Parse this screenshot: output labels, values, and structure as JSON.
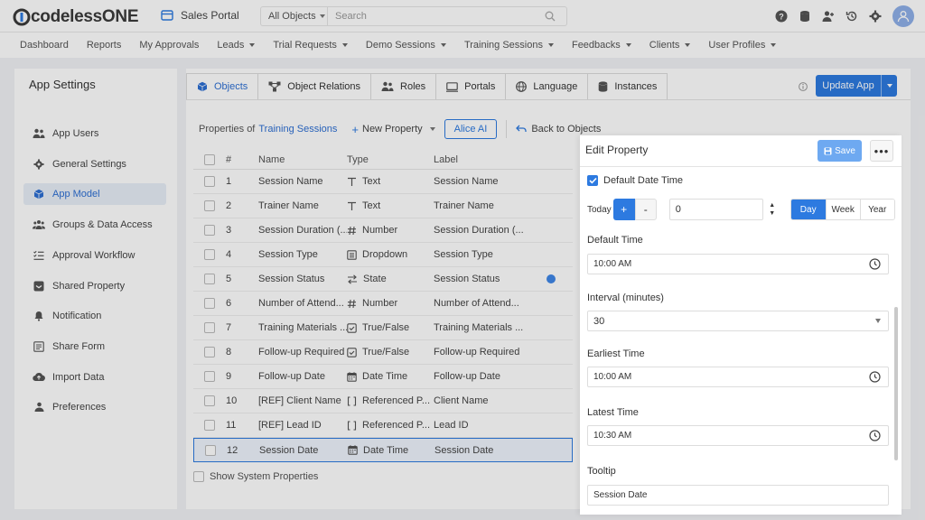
{
  "brand": {
    "logo_text": "codelessONE"
  },
  "portal": {
    "name": "Sales Portal"
  },
  "search": {
    "scope": "All Objects",
    "placeholder": "Search"
  },
  "nav": [
    "Dashboard",
    "Reports",
    "My Approvals",
    "Leads",
    "Trial Requests",
    "Demo Sessions",
    "Training Sessions",
    "Feedbacks",
    "Clients",
    "User Profiles"
  ],
  "nav_has_caret": [
    false,
    false,
    false,
    true,
    true,
    true,
    true,
    true,
    true,
    true
  ],
  "sidebar": {
    "title": "App Settings",
    "items": [
      {
        "label": "App Users",
        "icon": "users-icon"
      },
      {
        "label": "General Settings",
        "icon": "gear-icon"
      },
      {
        "label": "App Model",
        "icon": "cube-icon"
      },
      {
        "label": "Groups & Data Access",
        "icon": "group-icon"
      },
      {
        "label": "Approval Workflow",
        "icon": "checklist-icon"
      },
      {
        "label": "Shared Property",
        "icon": "shared-icon"
      },
      {
        "label": "Notification",
        "icon": "bell-icon"
      },
      {
        "label": "Share Form",
        "icon": "form-icon"
      },
      {
        "label": "Import Data",
        "icon": "cloud-upload-icon"
      },
      {
        "label": "Preferences",
        "icon": "preferences-icon"
      }
    ],
    "active_index": 2
  },
  "tabs": [
    {
      "label": "Objects",
      "icon": "cube-icon",
      "active": true
    },
    {
      "label": "Object Relations",
      "icon": "relations-icon"
    },
    {
      "label": "Roles",
      "icon": "roles-icon"
    },
    {
      "label": "Portals",
      "icon": "portal-icon"
    },
    {
      "label": "Language",
      "icon": "globe-icon"
    },
    {
      "label": "Instances",
      "icon": "database-icon"
    }
  ],
  "update_button": "Update App",
  "subbar": {
    "properties_of": "Properties of",
    "object_name": "Training Sessions",
    "new_property": "New Property",
    "alice_ai": "Alice AI",
    "back": "Back to Objects"
  },
  "table": {
    "headers": {
      "num": "#",
      "name": "Name",
      "type": "Type",
      "label": "Label"
    },
    "rows": [
      {
        "num": "1",
        "name": "Session Name",
        "type": "Text",
        "type_icon": "text-icon",
        "label": "Session Name"
      },
      {
        "num": "2",
        "name": "Trainer Name",
        "type": "Text",
        "type_icon": "text-icon",
        "label": "Trainer Name"
      },
      {
        "num": "3",
        "name": "Session Duration (...",
        "type": "Number",
        "type_icon": "number-icon",
        "label": "Session Duration (..."
      },
      {
        "num": "4",
        "name": "Session Type",
        "type": "Dropdown",
        "type_icon": "dropdown-icon",
        "label": "Session Type"
      },
      {
        "num": "5",
        "name": "Session Status",
        "type": "State",
        "type_icon": "state-icon",
        "label": "Session Status",
        "dot": true
      },
      {
        "num": "6",
        "name": "Number of Attend...",
        "type": "Number",
        "type_icon": "number-icon",
        "label": "Number of Attend..."
      },
      {
        "num": "7",
        "name": "Training Materials ...",
        "type": "True/False",
        "type_icon": "checkbox-icon",
        "label": "Training Materials ..."
      },
      {
        "num": "8",
        "name": "Follow-up Required",
        "type": "True/False",
        "type_icon": "checkbox-icon",
        "label": "Follow-up Required"
      },
      {
        "num": "9",
        "name": "Follow-up Date",
        "type": "Date Time",
        "type_icon": "calendar-icon",
        "label": "Follow-up Date"
      },
      {
        "num": "10",
        "name": "[REF] Client Name",
        "type": "Referenced P...",
        "type_icon": "bracket-icon",
        "label": "Client Name"
      },
      {
        "num": "11",
        "name": "[REF] Lead ID",
        "type": "Referenced P...",
        "type_icon": "bracket-icon",
        "label": "Lead ID"
      },
      {
        "num": "12",
        "name": "Session Date",
        "type": "Date Time",
        "type_icon": "calendar-icon",
        "label": "Session Date",
        "selected": true
      }
    ]
  },
  "show_system": "Show System Properties",
  "edit_panel": {
    "title": "Edit Property",
    "save": "Save",
    "more": "•••",
    "default_date_time": "Default Date Time",
    "today": "Today",
    "plus": "+",
    "minus": "-",
    "offset_value": "0",
    "units": [
      "Day",
      "Week",
      "Year"
    ],
    "active_unit": "Day",
    "default_time_label": "Default Time",
    "default_time": "10:00 AM",
    "interval_label": "Interval (minutes)",
    "interval": "30",
    "earliest_label": "Earliest Time",
    "earliest": "10:00 AM",
    "latest_label": "Latest Time",
    "latest": "10:30 AM",
    "tooltip_label": "Tooltip",
    "tooltip": "Session Date"
  },
  "colors": {
    "accent": "#2d7ae0",
    "link": "#2d6fd3"
  }
}
